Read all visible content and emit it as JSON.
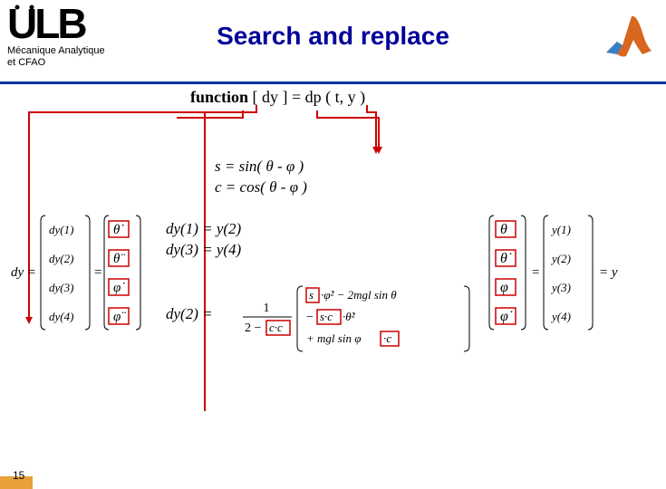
{
  "header": {
    "logo_text": "ULB",
    "dept_line1": "Mécanique Analytique",
    "dept_line2": "et CFAO",
    "title": "Search and replace"
  },
  "func": {
    "kw": "function",
    "rest": " [ dy ] = dp ( t, y )"
  },
  "sc": {
    "line1": "s = sin( θ - φ )",
    "line2": "c = cos( θ - φ )"
  },
  "dy": {
    "line1": "dy(1) = y(2)",
    "line2": "dy(3) = y(4)"
  },
  "dy2": "dy(2) =",
  "left_matrix": {
    "lhs": "dy =",
    "rows": [
      "dy(1)",
      "dy(2)",
      "dy(3)",
      "dy(4)"
    ],
    "sym": [
      "θ̇",
      "θ̈",
      "φ̇",
      "φ̈"
    ]
  },
  "right_matrix": {
    "rows_left": [
      "θ",
      "θ̇",
      "φ",
      "φ̇"
    ],
    "rows_right": [
      "y(1)",
      "y(2)",
      "y(3)",
      "y(4)"
    ],
    "rhs": "= y"
  },
  "frac": {
    "num_prefix": "1",
    "den": "2 − c·c",
    "r1a": "s",
    "r1b": "·φ̇² − 2mgl sin θ",
    "r2a": "s·c",
    "r2b": "·θ̇²",
    "r3a": "+ mgl sin φ",
    "r3b": "·c"
  },
  "page": "15"
}
